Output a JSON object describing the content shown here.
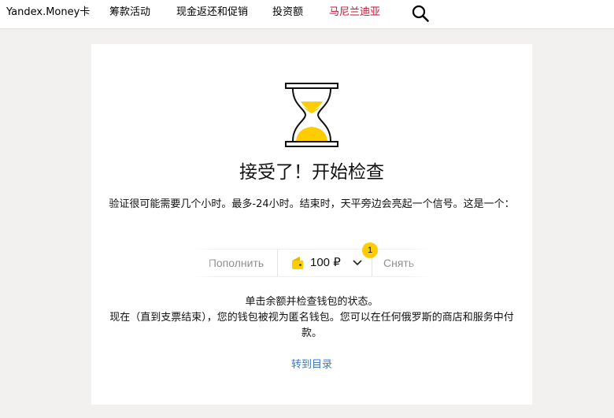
{
  "topbar": {
    "nav": [
      "Yandex.Money卡",
      "筹款活动",
      "现金返还和促销",
      "投资额",
      "马尼兰迪亚"
    ],
    "accent_color": "#c8102e",
    "search_icon": "magnifier"
  },
  "main": {
    "illustration_icon": "hourglass",
    "title": "接受了！开始检查",
    "description": "验证很可能需要几个小时。最多-24小时。结束时，天平旁边会亮起一个信号。这是一个：",
    "wallet": {
      "topup_label": "Пополнить",
      "balance": "100 ₽",
      "badge_count": "1",
      "withdraw_label": "Снять",
      "wallet_icon": "yellow-wallet",
      "dropdown_icon": "chevron-down"
    },
    "info_line1": "单击余额并检查钱包的状态。",
    "info_line2": "现在（直到支票结束），您的钱包被视为匿名钱包。您可以在任何俄罗斯的商店和服务中付款。",
    "catalog_link": "转到目录"
  },
  "colors": {
    "page_bg": "#f2f1ef",
    "brand_yellow": "#ffcc00",
    "link": "#3a79c2"
  }
}
